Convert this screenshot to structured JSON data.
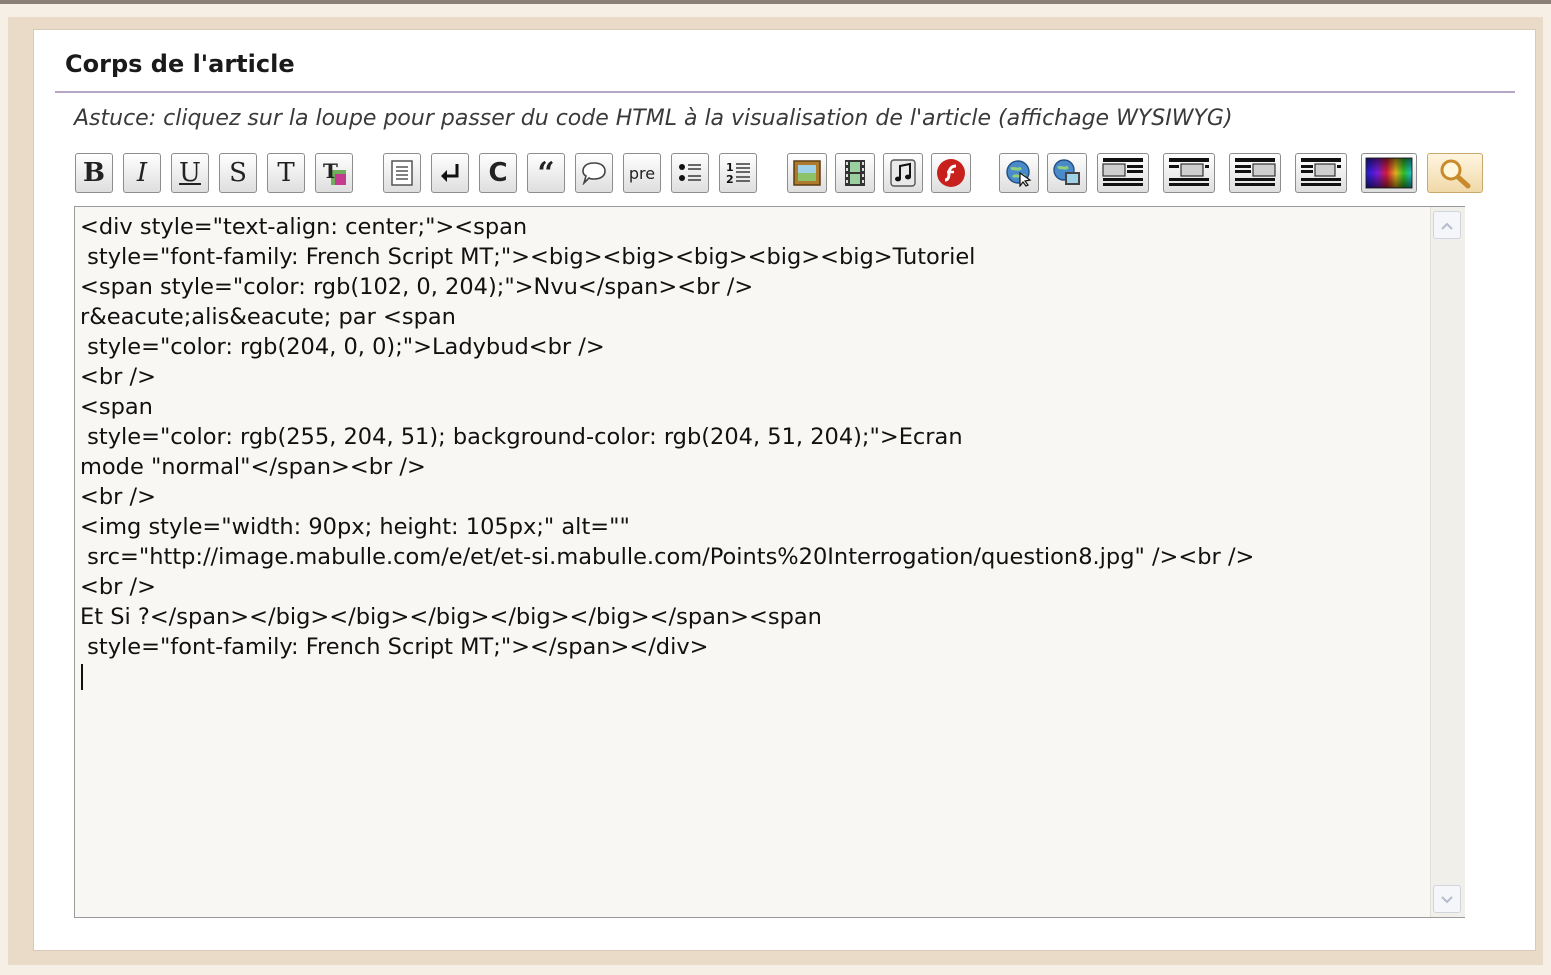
{
  "section": {
    "title": "Corps de l'article",
    "hint": "Astuce: cliquez sur la loupe pour passer du code HTML à la visualisation de l'article (affichage WYSIWYG)"
  },
  "toolbar": {
    "bold_label": "B",
    "italic_label": "I",
    "underline_label": "U",
    "strike_label": "S",
    "teletype_label": "T",
    "c_label": "C",
    "quote_label": "“",
    "pre_label": "pre",
    "icons": [
      "bold-icon",
      "italic-icon",
      "underline-icon",
      "strikethrough-icon",
      "teletype-icon",
      "text-color-icon",
      "paragraph-icon",
      "line-break-icon",
      "code-icon",
      "quote-icon",
      "comment-bubble-icon",
      "pre-icon",
      "bulleted-list-icon",
      "numbered-list-icon",
      "image-icon",
      "video-icon",
      "music-icon",
      "flash-icon",
      "link-icon",
      "link-image-icon",
      "image-left-align-icon",
      "image-center-align-icon",
      "image-right-align-icon",
      "image-justify-icon",
      "color-palette-icon",
      "magnifier-icon"
    ]
  },
  "editor": {
    "content": "<div style=\"text-align: center;\"><span\n style=\"font-family: French Script MT;\"><big><big><big><big><big>Tutoriel\n<span style=\"color: rgb(102, 0, 204);\">Nvu</span><br />\nr&eacute;alis&eacute; par <span\n style=\"color: rgb(204, 0, 0);\">Ladybud<br />\n<br />\n<span\n style=\"color: rgb(255, 204, 51); background-color: rgb(204, 51, 204);\">Ecran\nmode \"normal\"</span><br />\n<br />\n<img style=\"width: 90px; height: 105px;\" alt=\"\"\n src=\"http://image.mabulle.com/e/et/et-si.mabulle.com/Points%20Interrogation/question8.jpg\" /><br />\n<br />\nEt Si ?</span></big></big></big></big></big></span><span\n style=\"font-family: French Script MT;\"></span></div>"
  },
  "colors": {
    "page_bg": "#f6efe6",
    "frame_bg": "#eadbc9",
    "panel_bg": "#ffffff",
    "title_rule": "#b7a7c7",
    "editor_bg": "#f8f7f4"
  }
}
